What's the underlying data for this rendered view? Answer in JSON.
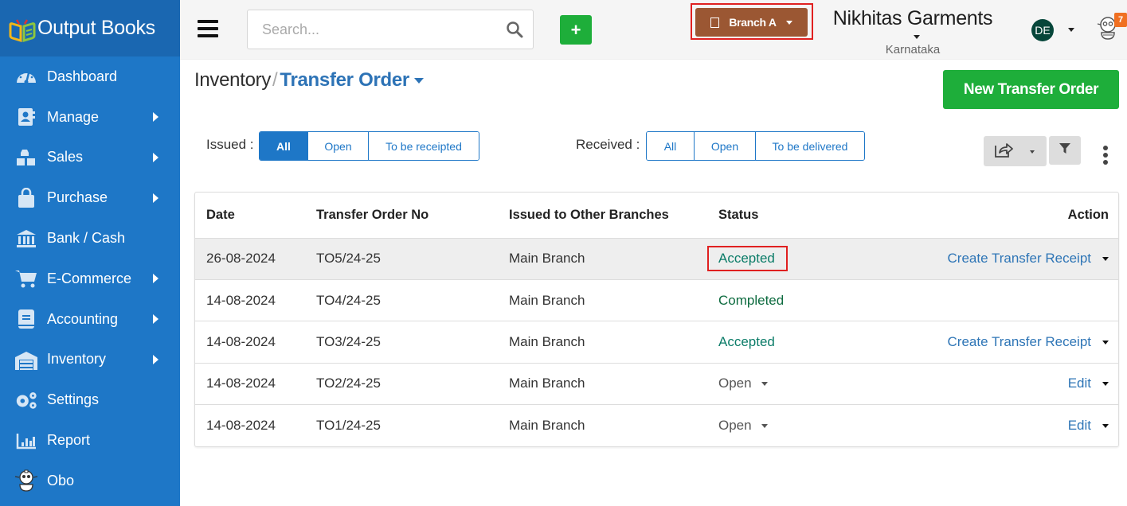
{
  "app": {
    "brand_name": "Output Books"
  },
  "sidebar": {
    "items": [
      {
        "label": "Dashboard",
        "icon": "dashboard-gauge-icon",
        "has_submenu": false
      },
      {
        "label": "Manage",
        "icon": "contact-book-icon",
        "has_submenu": true
      },
      {
        "label": "Sales",
        "icon": "cubes-icon",
        "has_submenu": true
      },
      {
        "label": "Purchase",
        "icon": "shopping-bag-icon",
        "has_submenu": true
      },
      {
        "label": "Bank / Cash",
        "icon": "bank-icon",
        "has_submenu": false
      },
      {
        "label": "E-Commerce",
        "icon": "cart-icon",
        "has_submenu": true
      },
      {
        "label": "Accounting",
        "icon": "ledger-book-icon",
        "has_submenu": true
      },
      {
        "label": "Inventory",
        "icon": "warehouse-icon",
        "has_submenu": true
      },
      {
        "label": "Settings",
        "icon": "gears-icon",
        "has_submenu": false
      },
      {
        "label": "Report",
        "icon": "bar-chart-icon",
        "has_submenu": false
      },
      {
        "label": "Obo",
        "icon": "robot-icon",
        "has_submenu": false
      }
    ]
  },
  "topbar": {
    "search_placeholder": "Search...",
    "add_label": "+",
    "branch_label": "Branch A",
    "company_name": "Nikhitas Garments",
    "company_state": "Karnataka",
    "avatar_initials": "DE",
    "notification_count": "7"
  },
  "page": {
    "breadcrumb_root": "Inventory",
    "breadcrumb_sep": "/",
    "breadcrumb_current": "Transfer Order",
    "new_button": "New Transfer Order"
  },
  "filters": {
    "issued_label": "Issued :",
    "issued_options": [
      "All",
      "Open",
      "To be receipted"
    ],
    "issued_selected": "All",
    "received_label": "Received :",
    "received_options": [
      "All",
      "Open",
      "To be delivered"
    ]
  },
  "table": {
    "columns": [
      "Date",
      "Transfer Order No",
      "Issued to Other Branches",
      "Status",
      "Action"
    ],
    "rows": [
      {
        "date": "26-08-2024",
        "order_no": "TO5/24-25",
        "branch": "Main Branch",
        "status": "Accepted",
        "action": "Create Transfer Receipt"
      },
      {
        "date": "14-08-2024",
        "order_no": "TO4/24-25",
        "branch": "Main Branch",
        "status": "Completed",
        "action": ""
      },
      {
        "date": "14-08-2024",
        "order_no": "TO3/24-25",
        "branch": "Main Branch",
        "status": "Accepted",
        "action": "Create Transfer Receipt"
      },
      {
        "date": "14-08-2024",
        "order_no": "TO2/24-25",
        "branch": "Main Branch",
        "status": "Open",
        "action": "Edit"
      },
      {
        "date": "14-08-2024",
        "order_no": "TO1/24-25",
        "branch": "Main Branch",
        "status": "Open",
        "action": "Edit"
      }
    ]
  },
  "colors": {
    "sidebar": "#1e77c7",
    "brand_bar": "#1a67b1",
    "primary_green": "#1eae3a",
    "branch_brown": "#9b5733",
    "link_blue": "#2e75b6",
    "accepted": "#0b7c68",
    "completed": "#0d6b3f",
    "highlight_outline": "#e02020",
    "badge_orange": "#f07022"
  }
}
